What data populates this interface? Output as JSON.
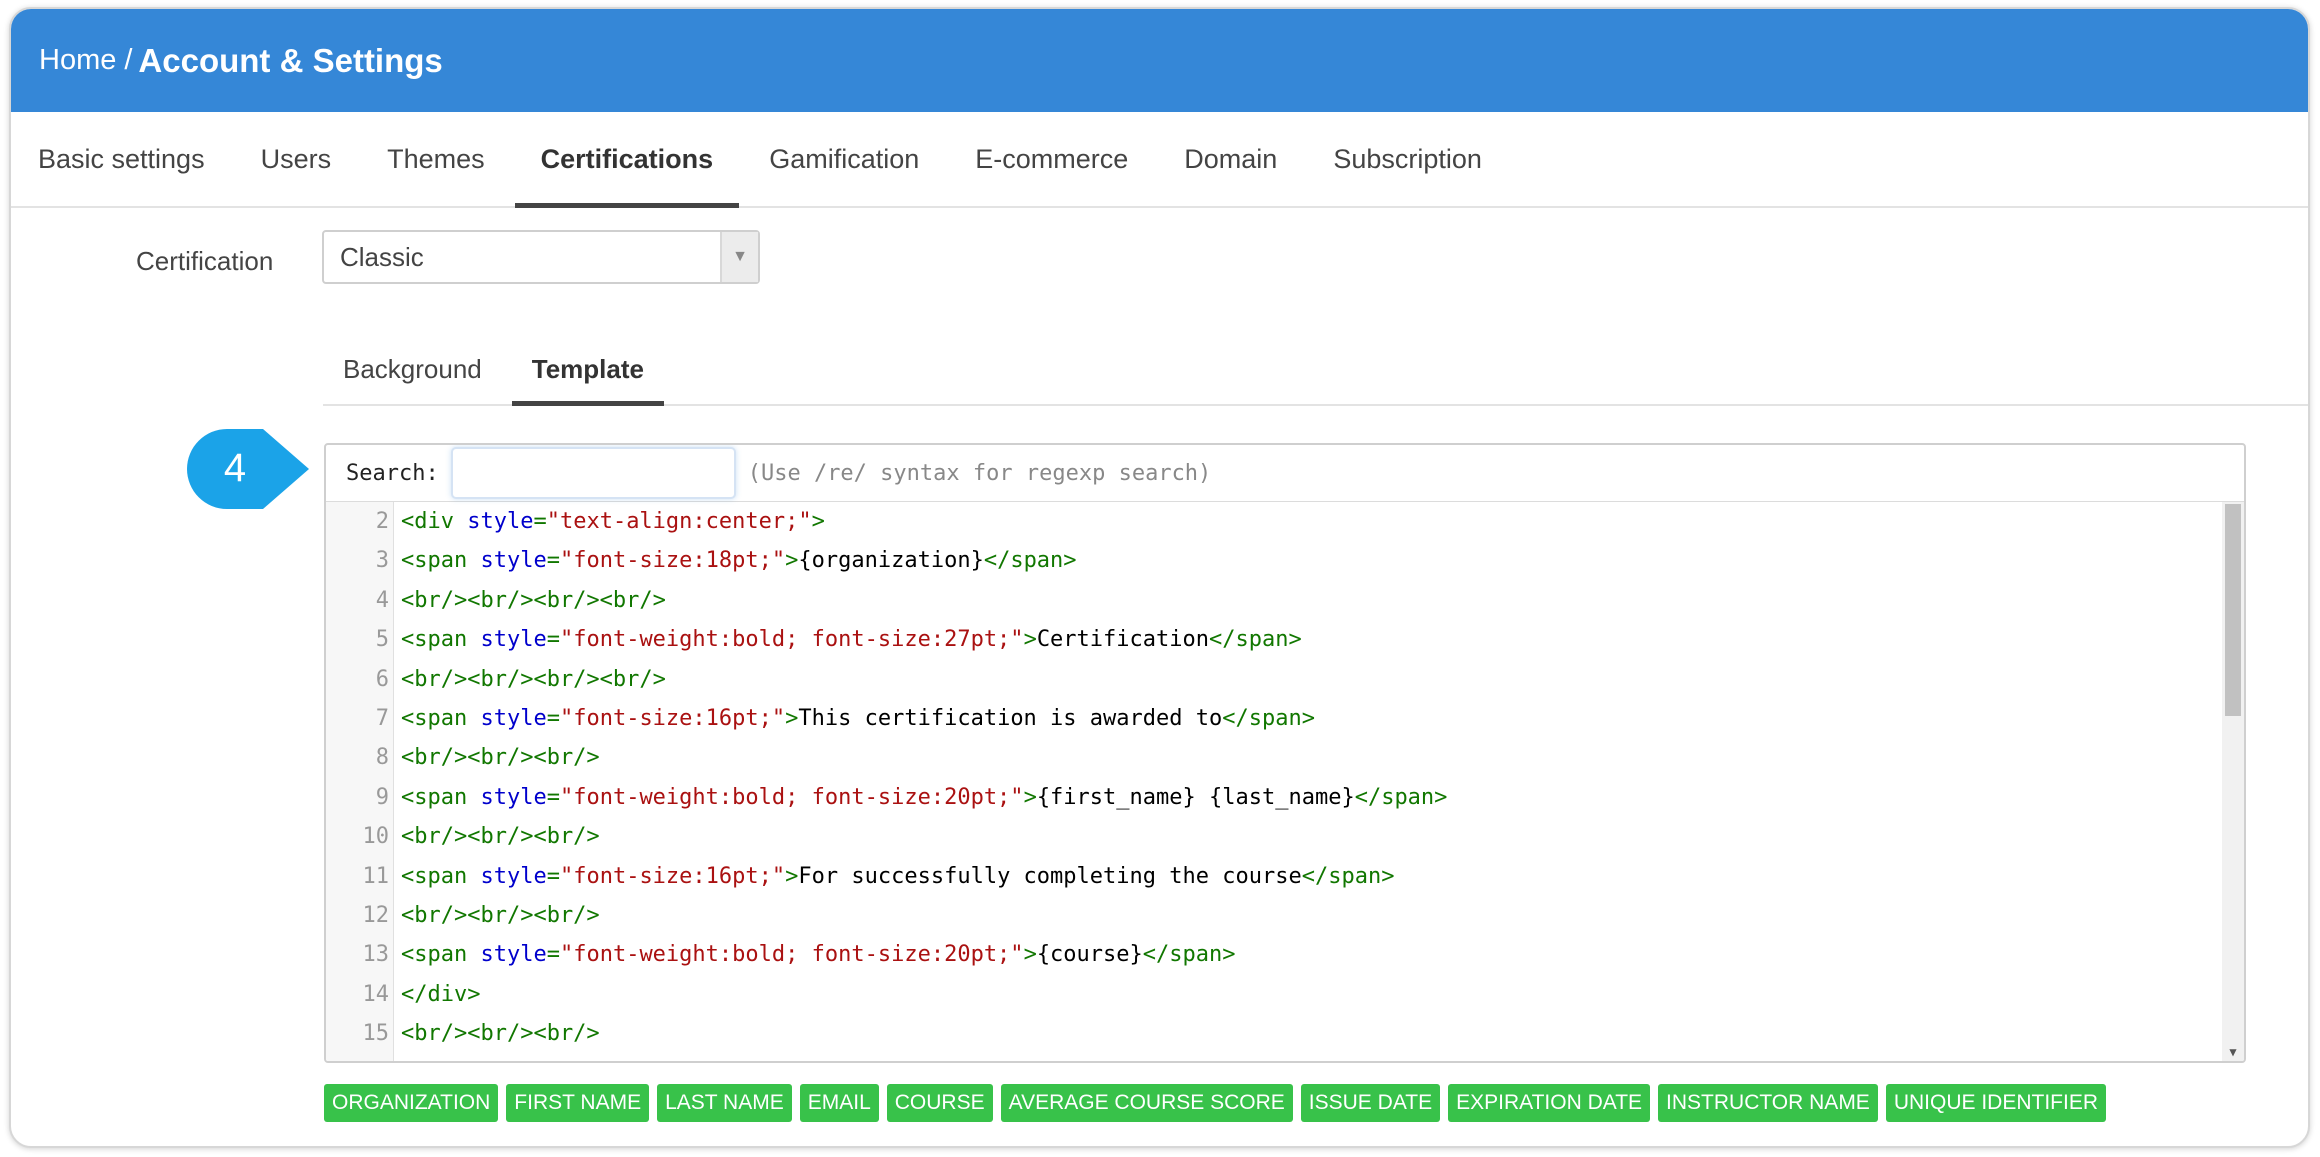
{
  "breadcrumb": {
    "home": "Home",
    "separator": "/",
    "current": "Account & Settings"
  },
  "main_tabs": [
    {
      "label": "Basic settings",
      "active": false
    },
    {
      "label": "Users",
      "active": false
    },
    {
      "label": "Themes",
      "active": false
    },
    {
      "label": "Certifications",
      "active": true
    },
    {
      "label": "Gamification",
      "active": false
    },
    {
      "label": "E-commerce",
      "active": false
    },
    {
      "label": "Domain",
      "active": false
    },
    {
      "label": "Subscription",
      "active": false
    }
  ],
  "certification": {
    "label": "Certification",
    "selected": "Classic"
  },
  "sub_tabs": [
    {
      "label": "Background",
      "active": false
    },
    {
      "label": "Template",
      "active": true
    }
  ],
  "step_number": "4",
  "colors": {
    "header": "#3587d7",
    "badge": "#1ba3e8",
    "tag": "#38c24a",
    "tag_text": "#ffffff"
  },
  "editor": {
    "search_label": "Search:",
    "search_value": "",
    "search_hint": "(Use /re/ syntax for regexp search)",
    "lines": [
      {
        "no": "2",
        "tokens": [
          [
            "tag",
            "<div "
          ],
          [
            "attr",
            "style"
          ],
          [
            "tag",
            "="
          ],
          [
            "str",
            "\"text-align:center;\""
          ],
          [
            "tag",
            ">"
          ]
        ]
      },
      {
        "no": "3",
        "tokens": [
          [
            "tag",
            "<span "
          ],
          [
            "attr",
            "style"
          ],
          [
            "tag",
            "="
          ],
          [
            "str",
            "\"font-size:18pt;\""
          ],
          [
            "tag",
            ">"
          ],
          [
            "text",
            "{organization}"
          ],
          [
            "tag",
            "</span>"
          ]
        ]
      },
      {
        "no": "4",
        "tokens": [
          [
            "tag",
            "<br/><br/><br/><br/>"
          ]
        ]
      },
      {
        "no": "5",
        "tokens": [
          [
            "tag",
            "<span "
          ],
          [
            "attr",
            "style"
          ],
          [
            "tag",
            "="
          ],
          [
            "str",
            "\"font-weight:bold; font-size:27pt;\""
          ],
          [
            "tag",
            ">"
          ],
          [
            "text",
            "Certification"
          ],
          [
            "tag",
            "</span>"
          ]
        ]
      },
      {
        "no": "6",
        "tokens": [
          [
            "tag",
            "<br/><br/><br/><br/>"
          ]
        ]
      },
      {
        "no": "7",
        "tokens": [
          [
            "tag",
            "<span "
          ],
          [
            "attr",
            "style"
          ],
          [
            "tag",
            "="
          ],
          [
            "str",
            "\"font-size:16pt;\""
          ],
          [
            "tag",
            ">"
          ],
          [
            "text",
            "This certification is awarded to"
          ],
          [
            "tag",
            "</span>"
          ]
        ]
      },
      {
        "no": "8",
        "tokens": [
          [
            "tag",
            "<br/><br/><br/>"
          ]
        ]
      },
      {
        "no": "9",
        "tokens": [
          [
            "tag",
            "<span "
          ],
          [
            "attr",
            "style"
          ],
          [
            "tag",
            "="
          ],
          [
            "str",
            "\"font-weight:bold; font-size:20pt;\""
          ],
          [
            "tag",
            ">"
          ],
          [
            "text",
            "{first_name} {last_name}"
          ],
          [
            "tag",
            "</span>"
          ]
        ]
      },
      {
        "no": "10",
        "tokens": [
          [
            "tag",
            "<br/><br/><br/>"
          ]
        ]
      },
      {
        "no": "11",
        "tokens": [
          [
            "tag",
            "<span "
          ],
          [
            "attr",
            "style"
          ],
          [
            "tag",
            "="
          ],
          [
            "str",
            "\"font-size:16pt;\""
          ],
          [
            "tag",
            ">"
          ],
          [
            "text",
            "For successfully completing the course"
          ],
          [
            "tag",
            "</span>"
          ]
        ]
      },
      {
        "no": "12",
        "tokens": [
          [
            "tag",
            "<br/><br/><br/>"
          ]
        ]
      },
      {
        "no": "13",
        "tokens": [
          [
            "tag",
            "<span "
          ],
          [
            "attr",
            "style"
          ],
          [
            "tag",
            "="
          ],
          [
            "str",
            "\"font-weight:bold; font-size:20pt;\""
          ],
          [
            "tag",
            ">"
          ],
          [
            "text",
            "{course}"
          ],
          [
            "tag",
            "</span>"
          ]
        ]
      },
      {
        "no": "14",
        "tokens": [
          [
            "tag",
            "</div>"
          ]
        ]
      },
      {
        "no": "15",
        "tokens": [
          [
            "tag",
            "<br/><br/><br/>"
          ]
        ]
      }
    ]
  },
  "placeholder_tags": [
    "ORGANIZATION",
    "FIRST NAME",
    "LAST NAME",
    "EMAIL",
    "COURSE",
    "AVERAGE COURSE SCORE",
    "ISSUE DATE",
    "EXPIRATION DATE",
    "INSTRUCTOR NAME",
    "UNIQUE IDENTIFIER"
  ]
}
